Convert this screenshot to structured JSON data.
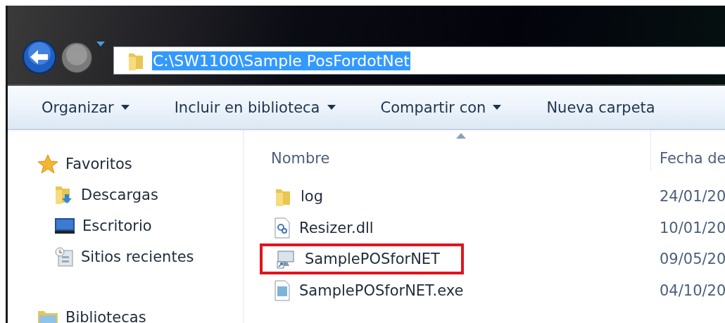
{
  "address": {
    "path": "C:\\SW1100\\Sample PosFordotNet",
    "selected": true
  },
  "toolbar": [
    {
      "label": "Organizar",
      "dropdown": true
    },
    {
      "label": "Incluir en biblioteca",
      "dropdown": true
    },
    {
      "label": "Compartir con",
      "dropdown": true
    },
    {
      "label": "Nueva carpeta",
      "dropdown": false
    }
  ],
  "sidebar": [
    {
      "label": "Favoritos",
      "kind": "star",
      "children": [
        {
          "label": "Descargas",
          "kind": "downloads"
        },
        {
          "label": "Escritorio",
          "kind": "desktop"
        },
        {
          "label": "Sitios recientes",
          "kind": "recent"
        }
      ]
    },
    {
      "label": "Bibliotecas",
      "kind": "library"
    }
  ],
  "file_list": {
    "columns": [
      {
        "label": "Nombre",
        "sorted": true
      },
      {
        "label": "Fecha de",
        "sorted": false
      }
    ],
    "rows": [
      {
        "name": "log",
        "kind": "folder",
        "date": "24/01/20",
        "highlighted": false
      },
      {
        "name": "Resizer.dll",
        "kind": "dll",
        "date": "10/01/20",
        "highlighted": false
      },
      {
        "name": "SamplePOSforNET",
        "kind": "shortcut",
        "date": "09/05/20",
        "highlighted": true
      },
      {
        "name": "SamplePOSforNET.exe",
        "kind": "exe",
        "date": "04/10/20",
        "highlighted": false
      }
    ]
  }
}
